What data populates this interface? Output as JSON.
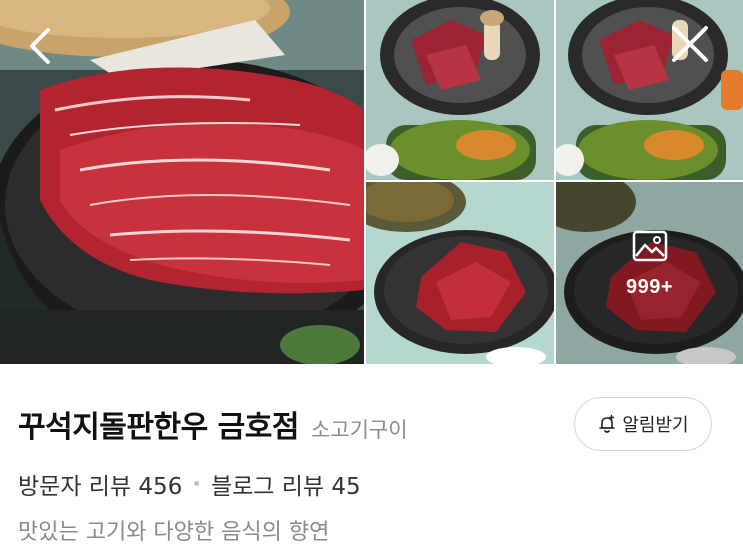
{
  "gallery": {
    "back_icon": "chevron-left-icon",
    "close_icon": "close-icon",
    "more_icon": "image-gallery-icon",
    "more_count": "999+"
  },
  "place": {
    "name": "꾸석지돌판한우 금호점",
    "category": "소고기구이",
    "alarm_label": "알림받기",
    "alarm_icon": "bell-plus-icon"
  },
  "reviews": {
    "visitor": "방문자 리뷰 456",
    "blog": "블로그 리뷰 45"
  },
  "description": "맛있는 고기와 다양한 음식의 향연",
  "colors": {
    "meat_red": "#a8202a",
    "plate_dark": "#262626",
    "table_mint": "#b6d6d0",
    "category_gray": "#8d8d8d",
    "border_gray": "#d6d6d6"
  }
}
